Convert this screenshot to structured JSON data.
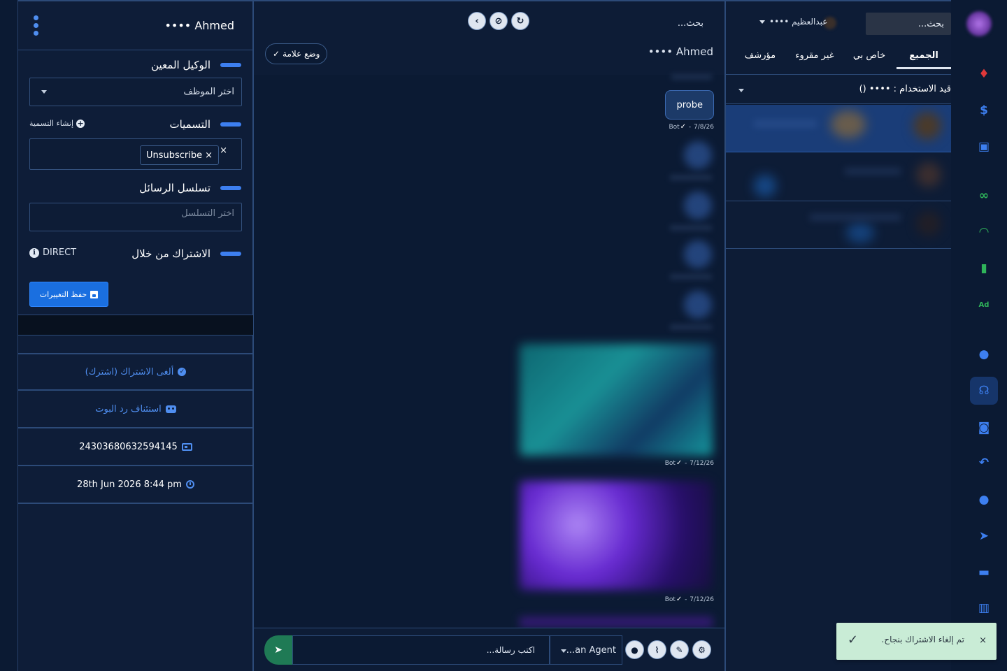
{
  "details": {
    "contact_name": "Ahmed ••••",
    "assigned_agent_title": "الوكيل المعين",
    "agent_select_value": "اختر الموظف",
    "labels_title": "التسميات",
    "create_label_text": "إنشاء التسمية",
    "label_chip": "Unsubscribe",
    "chip_remove": "×",
    "clear_all": "×",
    "sequence_title": "تسلسل الرسائل",
    "sequence_placeholder": "اختر التسلسل",
    "subscribed_via_title": "الاشتراك من خلال",
    "subscribed_via_value": "DIRECT",
    "save_button": "حفظ التغييرات",
    "unsubscribe_action": "ألغى الاشتراك (اشترك)",
    "resume_bot_action": "استئناف رد البوت",
    "subscriber_id": "24303680632594145",
    "subscribed_date": "28th Jun 2026 8:44 pm"
  },
  "chat": {
    "search_label": "بحث...",
    "contact_name": "Ahmed ••••",
    "mark_button": "وضع علامة",
    "messages": [
      {
        "text": "probe",
        "sender": "Bot",
        "date": "7/8/26"
      }
    ],
    "media_meta": [
      {
        "sender": "Bot",
        "date": "7/12/26"
      },
      {
        "sender": "Bot",
        "date": "7/12/26"
      }
    ],
    "input_placeholder": "اكتب رسالة...",
    "agent_select": "...an Agent"
  },
  "conversations": {
    "search_placeholder": "بحث...",
    "user_select": "عبدالعظيم ••••",
    "tabs": [
      {
        "label": "الجميع",
        "active": true
      },
      {
        "label": "خاص بي",
        "active": false
      },
      {
        "label": "غير مقروء",
        "active": false
      },
      {
        "label": "مؤرشف",
        "active": false
      }
    ],
    "filter_label": "قيد الاستخدام : •••• ()"
  },
  "toast": {
    "message": "تم إلغاء الاشتراك بنجاح.",
    "close": "×"
  },
  "colors": {
    "accent": "#3d7ff0",
    "link": "#4f8ef0",
    "background": "#0b1a33",
    "panel": "#0e1d38",
    "send": "#1f7a55",
    "toast_bg": "#c9ecd6"
  },
  "rail_icons": [
    "avatar",
    "fire-icon",
    "dollar-icon",
    "cast-icon",
    "link-icon",
    "wifi-icon",
    "chip-icon",
    "ad-icon",
    "user-icon",
    "headset-icon",
    "robot-icon",
    "reply-all-icon",
    "chat-bubble-icon",
    "send-icon",
    "inbox-icon",
    "trash-icon"
  ]
}
